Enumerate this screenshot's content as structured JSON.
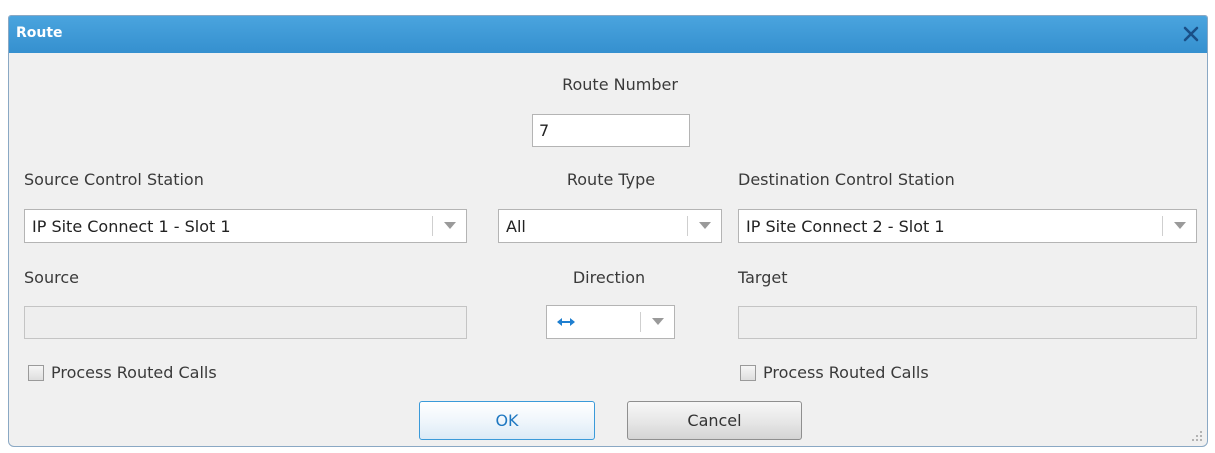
{
  "dialog": {
    "title": "Route",
    "route_number_label": "Route Number",
    "route_number_value": "7",
    "source_control_station": {
      "label": "Source Control Station",
      "value": "IP Site Connect 1 - Slot 1"
    },
    "route_type": {
      "label": "Route Type",
      "value": "All"
    },
    "destination_control_station": {
      "label": "Destination Control Station",
      "value": "IP Site Connect 2 - Slot 1"
    },
    "source": {
      "label": "Source",
      "value": ""
    },
    "direction": {
      "label": "Direction",
      "value_icon": "bidirectional-arrow-icon",
      "icon_color": "#1f7fd0"
    },
    "target": {
      "label": "Target",
      "value": ""
    },
    "source_process_routed_calls": {
      "label": "Process Routed Calls",
      "checked": false
    },
    "target_process_routed_calls": {
      "label": "Process Routed Calls",
      "checked": false
    },
    "ok_label": "OK",
    "cancel_label": "Cancel"
  },
  "colors": {
    "titlebar": "#3a97d6",
    "dialog_background": "#f0f0f0",
    "ok_border": "#3a9ad9"
  }
}
